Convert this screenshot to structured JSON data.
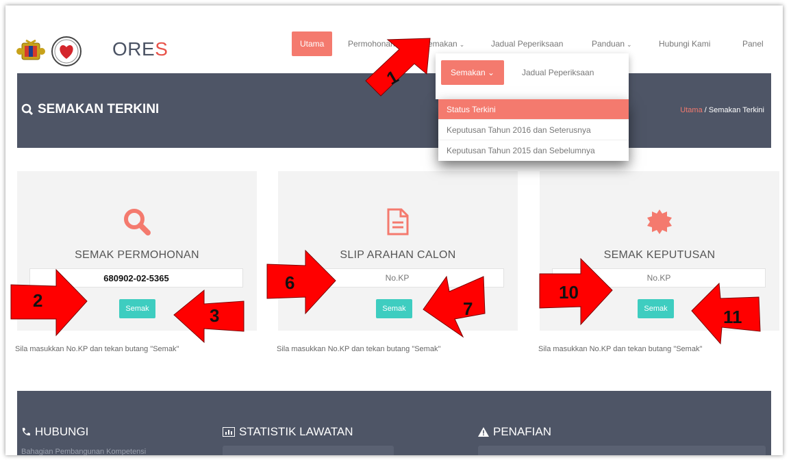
{
  "header": {
    "brand_prefix": "ORE",
    "brand_accent": "S",
    "nav": [
      {
        "label": "Utama",
        "active": true
      },
      {
        "label": "Permohonan"
      },
      {
        "label": "Semakan",
        "chevron": "⌄"
      },
      {
        "label": "Jadual Peperiksaan"
      },
      {
        "label": "Panduan",
        "chevron": "⌄"
      },
      {
        "label": "Hubungi Kami"
      },
      {
        "label": "Panel"
      }
    ]
  },
  "dropdown": {
    "button_label": "Semakan ⌄",
    "link_label": "Jadual Peperiksaan",
    "items": [
      "Status Terkini",
      "Keputusan Tahun 2016 dan Seterusnya",
      "Keputusan Tahun 2015 dan Sebelumnya"
    ]
  },
  "banner": {
    "title": "SEMAKAN TERKINI",
    "crumb_home": "Utama",
    "crumb_sep": " / ",
    "crumb_current": "Semakan Terkini"
  },
  "cards": [
    {
      "title": "SEMAK PERMOHONAN",
      "input_value": "680902-02-5365",
      "placeholder": "No.KP",
      "button": "Semak",
      "help": "Sila masukkan No.KP dan tekan butang \"Semak\"",
      "icon": "search-icon"
    },
    {
      "title": "SLIP ARAHAN CALON",
      "input_value": "",
      "placeholder": "No.KP",
      "button": "Semak",
      "help": "Sila masukkan No.KP dan tekan butang \"Semak\"",
      "icon": "document-icon"
    },
    {
      "title": "SEMAK KEPUTUSAN",
      "input_value": "",
      "placeholder": "No.KP",
      "button": "Semak",
      "help": "Sila masukkan No.KP dan tekan butang \"Semak\"",
      "icon": "certificate-icon"
    }
  ],
  "footer": {
    "contact": "HUBUNGI",
    "stats": "STATISTIK LAWATAN",
    "disclaimer": "PENAFIAN",
    "contact_sub": "Bahagian Pembangunan Kompetensi"
  },
  "annotations": [
    "1",
    "2",
    "3",
    "6",
    "7",
    "10",
    "11"
  ],
  "colors": {
    "accent": "#f47a6e",
    "teal": "#3ecdc0",
    "banner": "#4e5566",
    "arrow": "#ff0000"
  }
}
